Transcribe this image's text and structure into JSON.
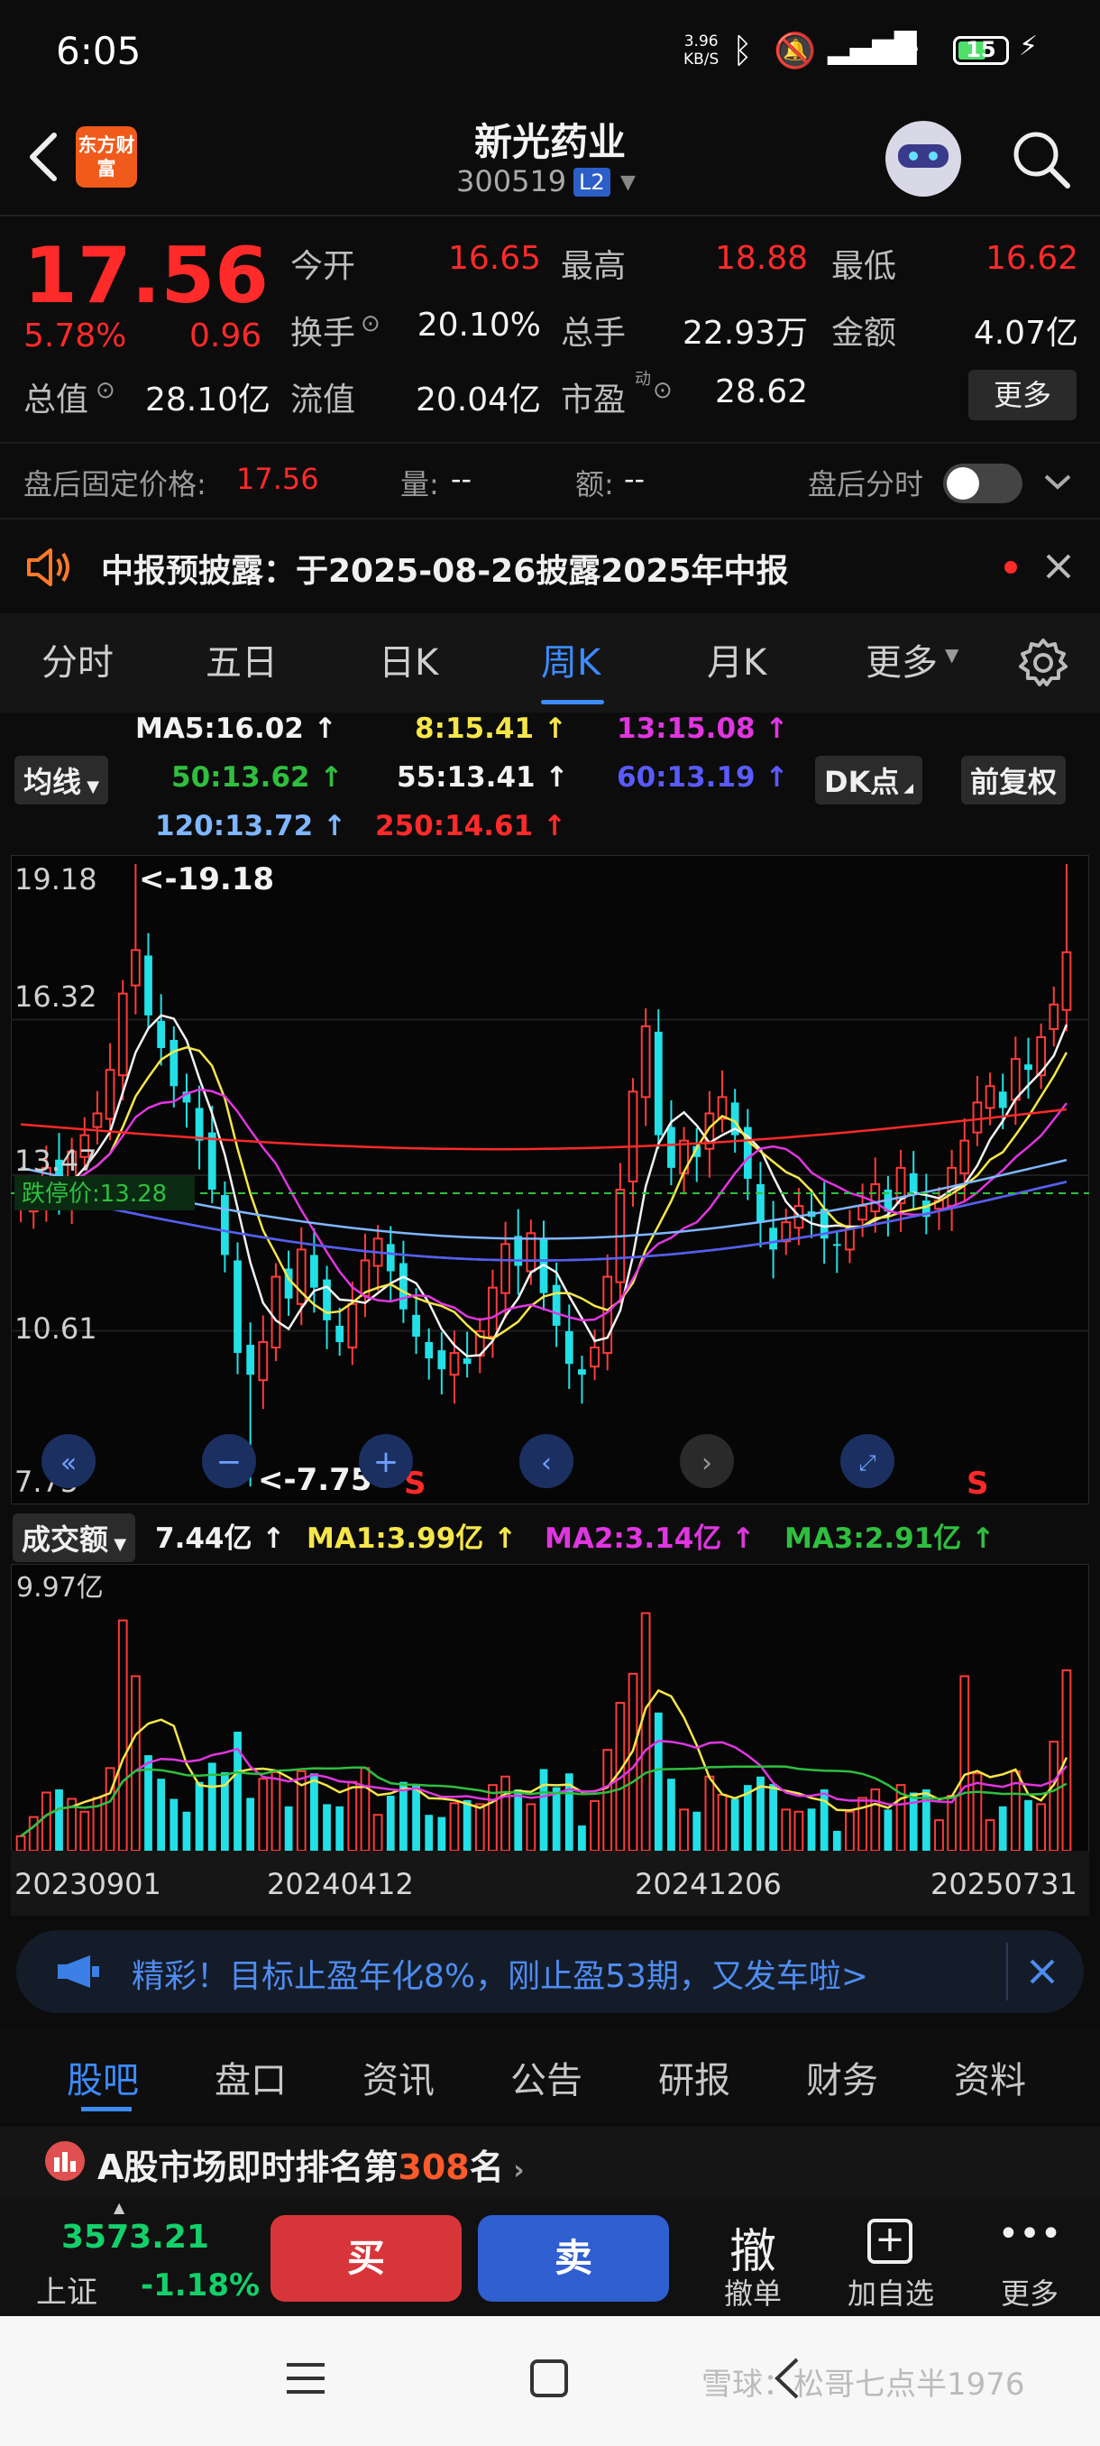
{
  "status_bar": {
    "time": "6:05",
    "net_speed_value": "3.96",
    "net_speed_unit": "KB/S",
    "battery": "15"
  },
  "header": {
    "app_logo_text": "东方财富",
    "stock_name": "新光药业",
    "stock_code": "300519",
    "level_badge": "L2"
  },
  "quote": {
    "price": "17.56",
    "change_pct": "5.78%",
    "change_amt": "0.96",
    "fields": [
      {
        "label": "今开",
        "value": "16.65"
      },
      {
        "label": "最高",
        "value": "18.88"
      },
      {
        "label": "最低",
        "value": "16.62"
      },
      {
        "label": "换手",
        "value": "20.10%"
      },
      {
        "label": "总手",
        "value": "22.93万"
      },
      {
        "label": "金额",
        "value": "4.07亿"
      },
      {
        "label": "总值",
        "value": "28.10亿"
      },
      {
        "label": "流值",
        "value": "20.04亿"
      },
      {
        "label": "市盈",
        "value": "28.62"
      }
    ],
    "pe_superscript": "动",
    "more_button": "更多"
  },
  "after_hours": {
    "fixed_price_label": "盘后固定价格:",
    "fixed_price_value": "17.56",
    "volume_label": "量:",
    "volume_value": "--",
    "amount_label": "额:",
    "amount_value": "--",
    "timeshare_label": "盘后分时"
  },
  "notice": {
    "text": "中报预披露：于2025-08-26披露2025年中报"
  },
  "chart_tabs": [
    "分时",
    "五日",
    "日K",
    "周K",
    "月K",
    "更多"
  ],
  "active_chart_tab": "周K",
  "ma_legend": {
    "toggle_label": "均线",
    "items": [
      {
        "text": "MA5:16.02",
        "arrow": "↑",
        "color": "#f2f2f2"
      },
      {
        "text": "8:15.41",
        "arrow": "↑",
        "color": "#f5e64a"
      },
      {
        "text": "13:15.08",
        "arrow": "↑",
        "color": "#e036e0"
      },
      {
        "text": "50:13.62",
        "arrow": "↑",
        "color": "#2fbf3f"
      },
      {
        "text": "55:13.41",
        "arrow": "↑",
        "color": "#f2f2f2"
      },
      {
        "text": "60:13.19",
        "arrow": "↑",
        "color": "#5a5aff"
      },
      {
        "text": "120:13.72",
        "arrow": "↑",
        "color": "#7fb6ff"
      },
      {
        "text": "250:14.61",
        "arrow": "↑",
        "color": "#ff2a2a"
      }
    ],
    "dk_button": "DK点",
    "adjust_button": "前复权"
  },
  "kline": {
    "y_labels": [
      "19.18",
      "16.32",
      "13.47",
      "10.61",
      "7.75"
    ],
    "high_marker": "<-19.18",
    "low_marker": "<-7.75",
    "limit_down_label": "跌停价:13.28",
    "signal_label": "S"
  },
  "volume": {
    "toggle_label": "成交额",
    "current": "7.44亿",
    "ma1": "MA1:3.99亿",
    "ma2": "MA2:3.14亿",
    "ma3": "MA3:2.91亿",
    "arrow": "↑",
    "y_max_label": "9.97亿",
    "x_labels": [
      "20230901",
      "20240412",
      "20241206",
      "20250731"
    ]
  },
  "chart_data": {
    "type": "candlestick",
    "period": "weekly",
    "ylim": [
      7.75,
      19.18
    ],
    "approx_closes": [
      12.9,
      13.1,
      13.6,
      13.2,
      13.9,
      14.2,
      14.6,
      15.4,
      16.8,
      17.6,
      16.4,
      15.8,
      15.1,
      14.8,
      14.1,
      13.2,
      12.0,
      10.2,
      9.8,
      10.4,
      11.6,
      11.2,
      12.1,
      11.4,
      10.8,
      10.4,
      11.1,
      11.9,
      12.3,
      11.7,
      11.0,
      10.5,
      10.1,
      9.9,
      10.2,
      10.0,
      10.6,
      11.4,
      12.2,
      11.8,
      12.4,
      11.3,
      10.7,
      10.0,
      9.8,
      10.3,
      11.6,
      13.2,
      15.0,
      16.2,
      14.2,
      13.6,
      14.1,
      13.8,
      14.6,
      14.9,
      14.2,
      13.4,
      12.6,
      12.1,
      12.6,
      12.9,
      12.7,
      12.3,
      12.2,
      12.5,
      12.9,
      13.3,
      12.8,
      13.6,
      13.1,
      12.7,
      13.0,
      13.6,
      14.1,
      14.8,
      15.1,
      14.7,
      15.6,
      15.4,
      16.0,
      16.6,
      17.56
    ],
    "volume_ylim": [
      0,
      9.97
    ],
    "volume_unit": "亿"
  },
  "banner": {
    "text": "精彩！目标止盈年化8%，刚止盈53期，又发车啦>"
  },
  "bottom_tabs": [
    "股吧",
    "盘口",
    "资讯",
    "公告",
    "研报",
    "财务",
    "资料"
  ],
  "active_bottom_tab": "股吧",
  "rank": {
    "prefix": "A股市场即时排名第",
    "number": "308",
    "suffix": "名"
  },
  "action_bar": {
    "index_value": "3573.21",
    "index_name": "上证",
    "index_change": "-1.18%",
    "buy": "买",
    "sell": "卖",
    "cancel_icon": "撤",
    "cancel_label": "撤单",
    "add_label": "加自选",
    "more_label": "更多"
  },
  "watermark": "雪球：松哥七点半1976"
}
